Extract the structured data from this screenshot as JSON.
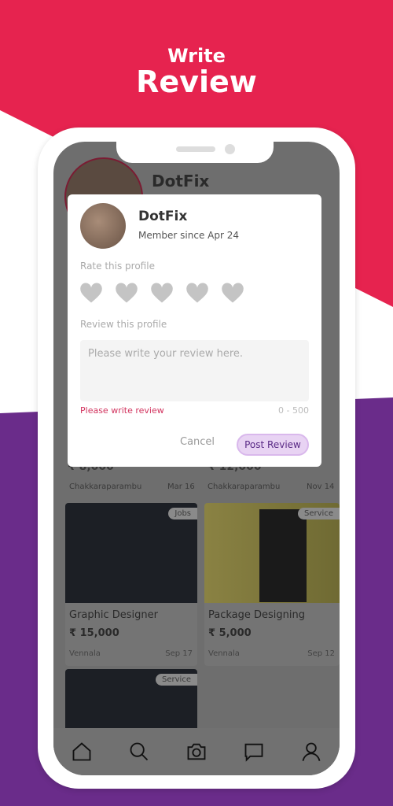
{
  "headline": {
    "line1": "Write",
    "line2": "Review"
  },
  "colors": {
    "pink": "#e6234f",
    "purple": "#6a2c8a",
    "accent": "#d2335e",
    "button_bg": "#e8d3f3"
  },
  "profile_bg": {
    "name": "DotFix"
  },
  "listings": [
    {
      "title": "",
      "price": "₹ 8,000",
      "location": "Chakkaraparambu",
      "date": "Mar 16",
      "tag": ""
    },
    {
      "title": "",
      "price": "₹ 12,000",
      "location": "Chakkaraparambu",
      "date": "Nov 14",
      "tag": "Service"
    },
    {
      "title": "Graphic Designer",
      "price": "₹ 15,000",
      "location": "Vennala",
      "date": "Sep 17",
      "tag": "Jobs"
    },
    {
      "title": "Package Designing",
      "price": "₹ 5,000",
      "location": "Vennala",
      "date": "Sep 12",
      "tag": "Service"
    },
    {
      "tag": "Service"
    }
  ],
  "nav": [
    "home-icon",
    "search-icon",
    "camera-sell-icon",
    "chat-icon",
    "profile-icon"
  ],
  "dialog": {
    "avatar_text": "DotFix",
    "name": "DotFix",
    "member_since": "Member since Apr 24",
    "rate_label": "Rate this profile",
    "rating": 0,
    "rating_max": 5,
    "review_label": "Review this profile",
    "placeholder": "Please write your review here.",
    "error": "Please write review",
    "counter": "0 - 500",
    "cancel": "Cancel",
    "post": "Post Review"
  }
}
